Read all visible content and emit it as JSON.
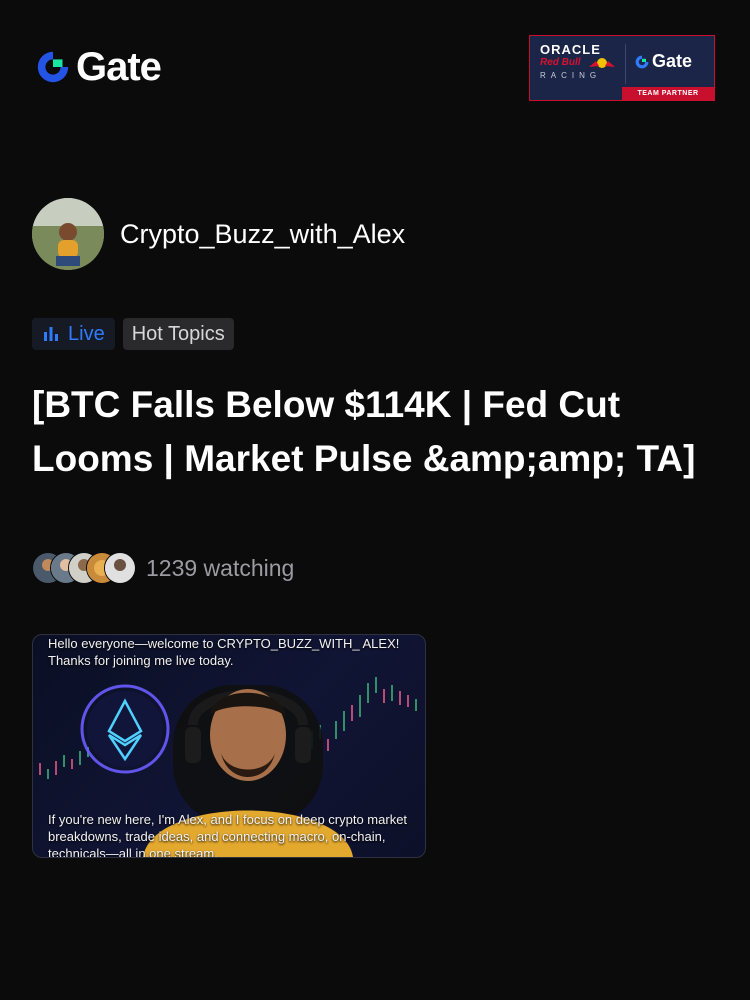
{
  "header": {
    "logo_text": "Gate",
    "logo_icon": "gate-logo-icon",
    "partner": {
      "oracle": "ORACLE",
      "redbull": "Red Bull",
      "racing": "RACING",
      "gate": "Gate",
      "badge": "TEAM PARTNER"
    }
  },
  "author": {
    "name": "Crypto_Buzz_with_Alex"
  },
  "tags": {
    "live": "Live",
    "topic": "Hot Topics"
  },
  "post": {
    "title": "[BTC Falls Below $114K | Fed Cut Looms | Market Pulse &amp;amp; TA]",
    "watching": "1239 watching"
  },
  "video": {
    "caption_top": "Hello everyone—welcome to CRYPTO_BUZZ_WITH_ ALEX! Thanks for joining me live today.",
    "caption_bottom": "If you're new here, I'm Alex, and I focus on deep crypto market breakdowns, trade ideas, and connecting macro, on-chain, technicals—all in one stream."
  },
  "colors": {
    "background": "#0b0b0c",
    "live_accent": "#2f7bff",
    "brand_blue": "#2354e6",
    "brand_green": "#17e7a1"
  }
}
